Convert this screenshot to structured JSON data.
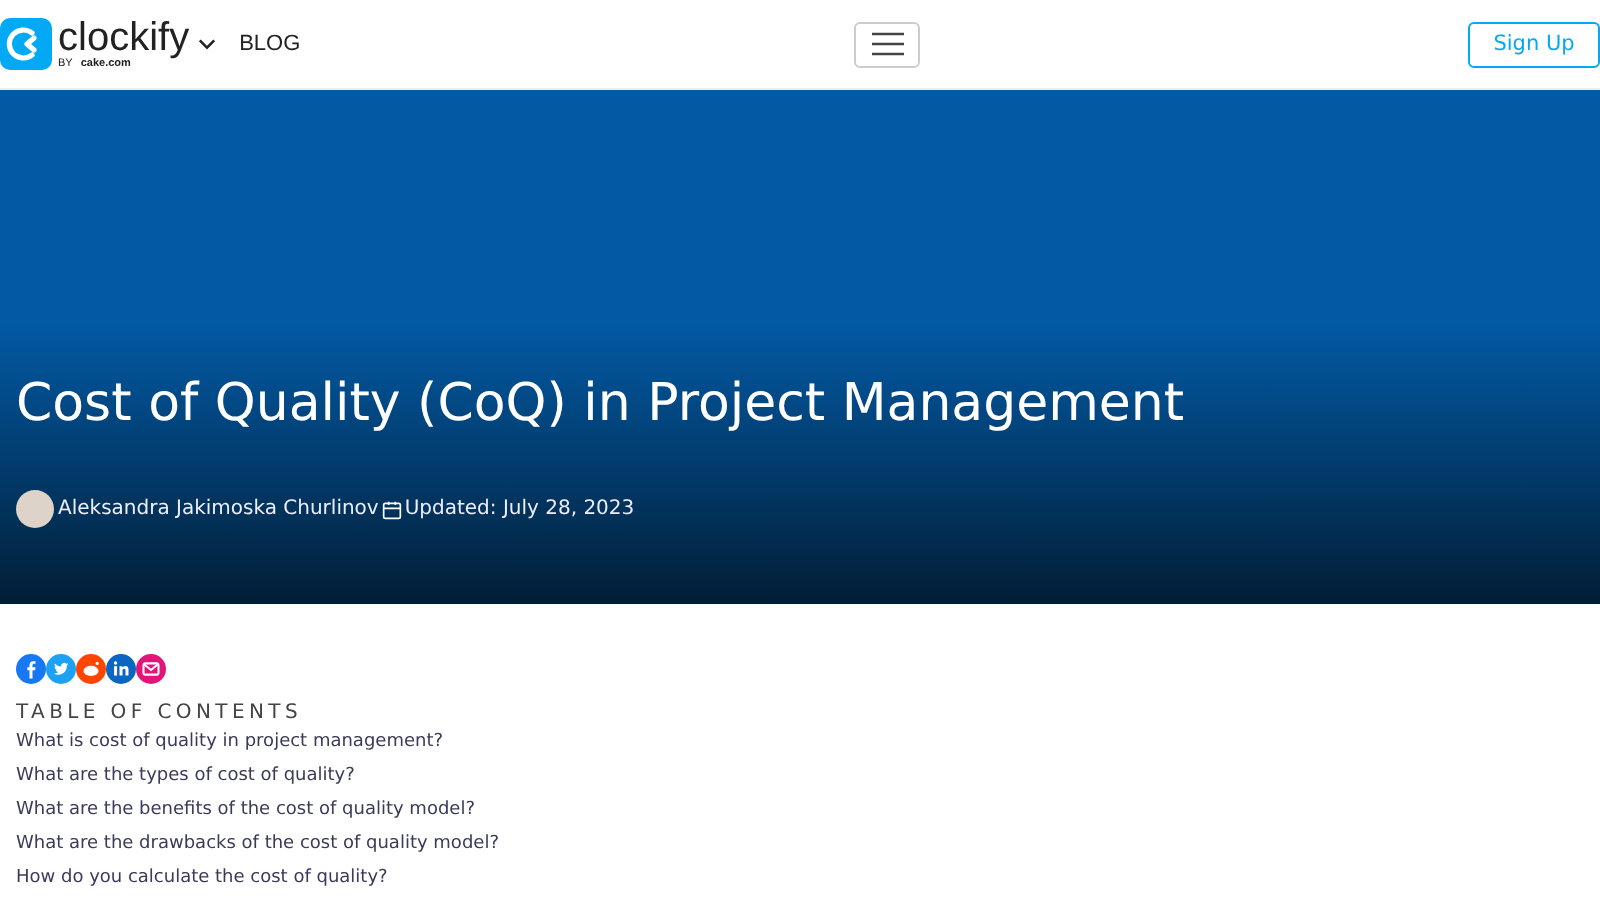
{
  "header": {
    "logo": {
      "name": "clockify",
      "byline": "BY",
      "brand": "cake.com"
    },
    "nav_link": "BLOG",
    "signup_button": "Sign Up"
  },
  "hero": {
    "title": "Cost of Quality (CoQ) in Project Management",
    "author": "Aleksandra Jakimoska Churlinov",
    "updated": "Updated: July 28, 2023"
  },
  "share_buttons": [
    {
      "kind": "facebook",
      "color": "#1877f2"
    },
    {
      "kind": "twitter",
      "color": "#1da1f2"
    },
    {
      "kind": "reddit",
      "color": "#ff4500"
    },
    {
      "kind": "linkedin",
      "color": "#0a66c2"
    },
    {
      "kind": "email",
      "color": "#e4157a"
    }
  ],
  "toc": {
    "heading": "TABLE OF CONTENTS",
    "items": [
      "What is cost of quality in project management?",
      "What are the types of cost of quality?",
      "What are the benefits of the cost of quality model?",
      "What are the drawbacks of the cost of quality model?",
      "How do you calculate the cost of quality?"
    ]
  }
}
